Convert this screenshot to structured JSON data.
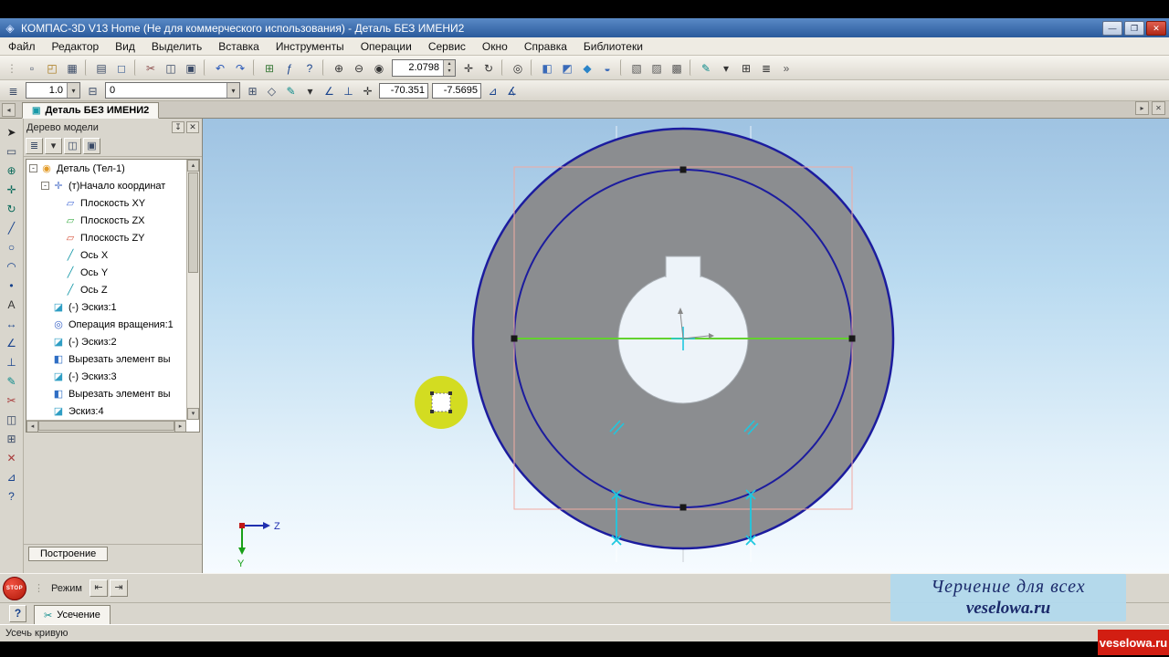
{
  "window": {
    "title": "КОМПАС-3D V13 Home (Не для коммерческого использования) - Деталь БЕЗ ИМЕНИ2",
    "app_icon_glyph": "◈",
    "minimize_glyph": "—",
    "maximize_glyph": "❐",
    "close_glyph": "✕"
  },
  "menu": {
    "items": [
      "Файл",
      "Редактор",
      "Вид",
      "Выделить",
      "Вставка",
      "Инструменты",
      "Операции",
      "Сервис",
      "Окно",
      "Справка",
      "Библиотеки"
    ]
  },
  "toolbar1": {
    "zoom_value": "2.0798",
    "spinner_up": "▴",
    "spinner_down": "▾",
    "icons_left": [
      {
        "n": "toolbar-grip",
        "g": "⋮",
        "c": "#9a968c"
      },
      {
        "n": "new-icon",
        "g": "▫",
        "c": "#3a4a66"
      },
      {
        "n": "open-icon",
        "g": "◰",
        "c": "#a87818"
      },
      {
        "n": "save-icon",
        "g": "▦",
        "c": "#3a4a66"
      },
      {
        "n": "separator",
        "g": ""
      },
      {
        "n": "print-icon",
        "g": "▤",
        "c": "#3a4a66"
      },
      {
        "n": "preview-icon",
        "g": "◻",
        "c": "#4a6a9a"
      },
      {
        "n": "separator",
        "g": ""
      },
      {
        "n": "cut-icon",
        "g": "✂",
        "c": "#8a4a4a"
      },
      {
        "n": "copy-icon",
        "g": "◫",
        "c": "#3a4a66"
      },
      {
        "n": "paste-icon",
        "g": "▣",
        "c": "#3a4a66"
      },
      {
        "n": "separator",
        "g": ""
      },
      {
        "n": "undo-icon",
        "g": "↶",
        "c": "#2858b8"
      },
      {
        "n": "redo-icon",
        "g": "↷",
        "c": "#2858b8"
      },
      {
        "n": "separator",
        "g": ""
      },
      {
        "n": "table-icon",
        "g": "⊞",
        "c": "#3a7a3a"
      },
      {
        "n": "fx-icon",
        "g": "ƒ",
        "c": "#16418c"
      },
      {
        "n": "whats-this-icon",
        "g": "?",
        "c": "#16418c"
      },
      {
        "n": "separator",
        "g": ""
      },
      {
        "n": "zoom-in-icon",
        "g": "⊕",
        "c": "#333333"
      },
      {
        "n": "zoom-out-icon",
        "g": "⊖",
        "c": "#333333"
      },
      {
        "n": "zoom-area-icon",
        "g": "◉",
        "c": "#333333"
      }
    ],
    "icons_right": [
      {
        "n": "pan-icon",
        "g": "✛",
        "c": "#333333"
      },
      {
        "n": "rotate-icon",
        "g": "↻",
        "c": "#333333"
      },
      {
        "n": "separator",
        "g": ""
      },
      {
        "n": "zoom-fit-icon",
        "g": "◎",
        "c": "#333333"
      },
      {
        "n": "separator",
        "g": ""
      },
      {
        "n": "view-front-icon",
        "g": "◧",
        "c": "#3a6ab8"
      },
      {
        "n": "view-top-icon",
        "g": "◩",
        "c": "#3a6ab8"
      },
      {
        "n": "view-iso-icon",
        "g": "◆",
        "c": "#2a84c8"
      },
      {
        "n": "view-orientation-icon",
        "g": "◒",
        "c": "#3a6ab8"
      },
      {
        "n": "separator",
        "g": ""
      },
      {
        "n": "wireframe-icon",
        "g": "▧",
        "c": "#5a5a5a"
      },
      {
        "n": "hidden-lines-icon",
        "g": "▨",
        "c": "#5a5a5a"
      },
      {
        "n": "shaded-icon",
        "g": "▩",
        "c": "#5a5a5a"
      },
      {
        "n": "separator",
        "g": ""
      },
      {
        "n": "sketch-mode-icon",
        "g": "✎",
        "c": "#0a8a8a"
      },
      {
        "n": "dropdown-arrow-icon",
        "g": "▾",
        "c": "#333333"
      },
      {
        "n": "macro-icon",
        "g": "⊞",
        "c": "#333333"
      },
      {
        "n": "library-icon",
        "g": "≣",
        "c": "#333333"
      },
      {
        "n": "overflow-icon",
        "g": "»",
        "c": "#555555"
      }
    ]
  },
  "toolbar2": {
    "line_width_value": "1.0",
    "layer_value": "0",
    "coord_x": "-70.351",
    "coord_y": "-7.5695",
    "dropdown": "▾",
    "icons_left": [
      {
        "n": "layers-icon",
        "g": "≣",
        "c": "#3a4a66"
      }
    ],
    "icons_mid": [
      {
        "n": "layer-settings-icon",
        "g": "⊟",
        "c": "#3a4a66"
      }
    ],
    "icons_right": [
      {
        "n": "grid-icon",
        "g": "⊞",
        "c": "#3a4a66"
      },
      {
        "n": "rounding-icon",
        "g": "◇",
        "c": "#3a4a66"
      },
      {
        "n": "pencil-icon",
        "g": "✎",
        "c": "#0a8a8a"
      },
      {
        "n": "dropdown-arrow-icon",
        "g": "▾",
        "c": "#333333"
      },
      {
        "n": "angle-icon",
        "g": "∠",
        "c": "#16418c"
      },
      {
        "n": "ortho-icon",
        "g": "⊥",
        "c": "#16418c"
      },
      {
        "n": "snap-icon",
        "g": "✛",
        "c": "#333333"
      }
    ],
    "icons_end": [
      {
        "n": "triangle-icon",
        "g": "⊿",
        "c": "#16418c"
      },
      {
        "n": "measure-angle-icon",
        "g": "∡",
        "c": "#16418c"
      }
    ]
  },
  "tabbar": {
    "active_tab": "Деталь БЕЗ ИМЕНИ2",
    "tab_icon_glyph": "▣",
    "scroll_left_glyph": "◂",
    "scroll_right_glyph": "▸",
    "close_glyph": "✕"
  },
  "left_toolbar": {
    "icons": [
      {
        "n": "select-tool-icon",
        "g": "➤",
        "c": "#222222"
      },
      {
        "n": "marquee-tool-icon",
        "g": "▭",
        "c": "#3a4a66"
      },
      {
        "n": "zoom-tool-icon",
        "g": "⊕",
        "c": "#0a6a5a"
      },
      {
        "n": "pan-tool-icon",
        "g": "✛",
        "c": "#0a6a5a"
      },
      {
        "n": "rotate-tool-icon",
        "g": "↻",
        "c": "#0a6a5a"
      },
      {
        "n": "line-tool-icon",
        "g": "╱",
        "c": "#16418c"
      },
      {
        "n": "circle-tool-icon",
        "g": "○",
        "c": "#16418c"
      },
      {
        "n": "arc-tool-icon",
        "g": "◠",
        "c": "#16418c"
      },
      {
        "n": "point-tool-icon",
        "g": "•",
        "c": "#16418c"
      },
      {
        "n": "text-tool-icon",
        "g": "A",
        "c": "#333333"
      },
      {
        "n": "dimension-tool-icon",
        "g": "↔",
        "c": "#16418c"
      },
      {
        "n": "angle-tool-icon",
        "g": "∠",
        "c": "#16418c"
      },
      {
        "n": "perpendicular-tool-icon",
        "g": "⊥",
        "c": "#16418c"
      },
      {
        "n": "pencil-tool-icon",
        "g": "✎",
        "c": "#0a8a8a"
      },
      {
        "n": "trim-tool-icon",
        "g": "✂",
        "c": "#a83a3a"
      },
      {
        "n": "mirror-tool-icon",
        "g": "◫",
        "c": "#3a4a66"
      },
      {
        "n": "array-tool-icon",
        "g": "⊞",
        "c": "#3a4a66"
      },
      {
        "n": "erase-tool-icon",
        "g": "✕",
        "c": "#a83a3a"
      },
      {
        "n": "measure-tool-icon",
        "g": "⊿",
        "c": "#16418c"
      },
      {
        "n": "help-tool-icon",
        "g": "?",
        "c": "#16418c"
      }
    ]
  },
  "tree_panel": {
    "title": "Дерево модели",
    "pin_glyph": "↧",
    "close_glyph": "✕",
    "scrollbar": {
      "up": "▴",
      "down": "▾",
      "left": "◂",
      "right": "▸"
    },
    "toolbar": [
      {
        "n": "tree-display-icon",
        "g": "≣",
        "c": "#3a4a66"
      },
      {
        "n": "tree-dropdown-icon",
        "g": "▾",
        "c": "#333333"
      },
      {
        "n": "tree-composition-icon",
        "g": "◫",
        "c": "#3a4a66"
      },
      {
        "n": "tree-relations-icon",
        "g": "▣",
        "c": "#3a4a66"
      }
    ],
    "items": [
      {
        "label": "Деталь (Тел-1)",
        "level": 0,
        "expand": "-",
        "icon_glyph": "◉",
        "icon_color": "#e39b27",
        "icon_name": "part-icon"
      },
      {
        "label": "(т)Начало координат",
        "level": 1,
        "expand": "-",
        "icon_glyph": "✛",
        "icon_color": "#5577cc",
        "icon_name": "origin-icon"
      },
      {
        "label": "Плоскость XY",
        "level": 2,
        "expand": "",
        "icon_glyph": "▱",
        "icon_color": "#4a6fd8",
        "icon_name": "plane-xy-icon"
      },
      {
        "label": "Плоскость ZX",
        "level": 2,
        "expand": "",
        "icon_glyph": "▱",
        "icon_color": "#3fae4a",
        "icon_name": "plane-zx-icon"
      },
      {
        "label": "Плоскость ZY",
        "level": 2,
        "expand": "",
        "icon_glyph": "▱",
        "icon_color": "#d85840",
        "icon_name": "plane-zy-icon"
      },
      {
        "label": "Ось X",
        "level": 2,
        "expand": "",
        "icon_glyph": "╱",
        "icon_color": "#1899a8",
        "icon_name": "axis-x-icon"
      },
      {
        "label": "Ось Y",
        "level": 2,
        "expand": "",
        "icon_glyph": "╱",
        "icon_color": "#1899a8",
        "icon_name": "axis-y-icon"
      },
      {
        "label": "Ось Z",
        "level": 2,
        "expand": "",
        "icon_glyph": "╱",
        "icon_color": "#1899a8",
        "icon_name": "axis-z-icon"
      },
      {
        "label": "(-) Эскиз:1",
        "level": 1,
        "expand": "",
        "icon_glyph": "◪",
        "icon_color": "#2f9ec4",
        "icon_name": "sketch-icon"
      },
      {
        "label": "Операция вращения:1",
        "level": 1,
        "expand": "",
        "icon_glyph": "◎",
        "icon_color": "#3a64c8",
        "icon_name": "revolve-operation-icon"
      },
      {
        "label": "(-) Эскиз:2",
        "level": 1,
        "expand": "",
        "icon_glyph": "◪",
        "icon_color": "#2f9ec4",
        "icon_name": "sketch-icon"
      },
      {
        "label": "Вырезать элемент вы",
        "level": 1,
        "expand": "",
        "icon_glyph": "◧",
        "icon_color": "#2f6ec4",
        "icon_name": "cut-extrude-icon"
      },
      {
        "label": "(-) Эскиз:3",
        "level": 1,
        "expand": "",
        "icon_glyph": "◪",
        "icon_color": "#2f9ec4",
        "icon_name": "sketch-icon"
      },
      {
        "label": "Вырезать элемент вы",
        "level": 1,
        "expand": "",
        "icon_glyph": "◧",
        "icon_color": "#2f6ec4",
        "icon_name": "cut-extrude-icon"
      },
      {
        "label": "Эскиз:4",
        "level": 1,
        "expand": "",
        "icon_glyph": "◪",
        "icon_color": "#2f9ec4",
        "icon_name": "sketch-icon"
      }
    ],
    "footer_tab": "Построение"
  },
  "canvas": {
    "colors": {
      "disk": "#8b8d90",
      "circle_stroke": "#1c1c9e",
      "green_line": "#62d22e",
      "pink_rect": "#f2aaa2",
      "cyan": "#1ec8e0",
      "highlight": "#d3dc21",
      "hole_fill": "#edf3f9"
    },
    "axes": {
      "y_label": "Y",
      "z_label": "Z"
    }
  },
  "bottom_panel": {
    "stop_label": "STOP",
    "help_label": "?",
    "grip_glyph": "⋮",
    "mode_label": "Режим",
    "mode_icons": [
      {
        "n": "mode-prev-icon",
        "g": "⇤",
        "c": "#333333"
      },
      {
        "n": "mode-next-icon",
        "g": "⇥",
        "c": "#333333"
      }
    ],
    "trim_icon_glyph": "✂",
    "tab_label": "Усечение"
  },
  "statusbar": {
    "text": "Усечь кривую"
  },
  "watermark": {
    "line1": "Черчение для всех",
    "line2": "veselowa.ru"
  },
  "corner_badge": {
    "text": "veselowa.ru"
  }
}
